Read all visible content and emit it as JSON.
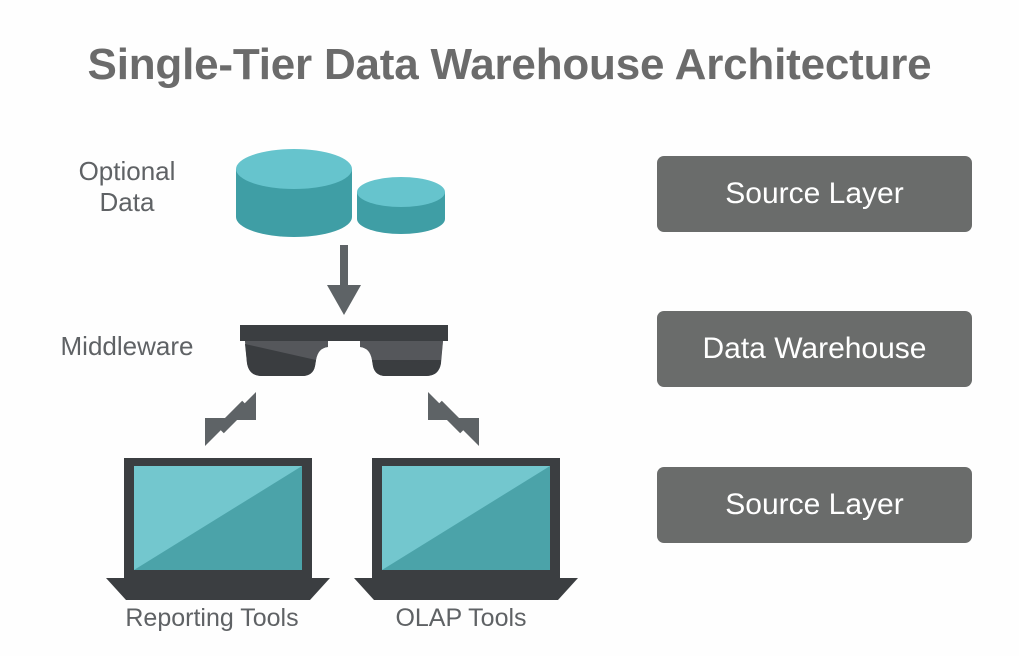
{
  "title": "Single-Tier Data Warehouse Architecture",
  "left_labels": {
    "optional_data": "Optional\nData",
    "optional_data_line1": "Optional",
    "optional_data_line2": "Data",
    "middleware": "Middleware"
  },
  "tool_labels": {
    "reporting_tools": "Reporting Tools",
    "olap_tools": "OLAP Tools"
  },
  "layer_boxes": [
    {
      "label": "Source Layer"
    },
    {
      "label": "Data Warehouse"
    },
    {
      "label": "Source Layer"
    }
  ],
  "icons": {
    "database_large": "database-cylinder-icon",
    "database_small": "database-cylinder-small-icon",
    "middleware": "sunglasses-middleware-icon",
    "laptop_left": "laptop-icon",
    "laptop_right": "laptop-icon",
    "arrow_down": "arrow-down-icon",
    "arrow_double_left": "double-arrow-diagonal-icon",
    "arrow_double_right": "double-arrow-diagonal-icon"
  },
  "colors": {
    "background": "#fefefe",
    "title_gray": "#6b6b6b",
    "label_gray": "#5f6265",
    "box_gray": "#6a6c6b",
    "box_text": "#ffffff",
    "teal_light": "#6cc6cf",
    "teal_mid": "#5bb8c0",
    "teal_dark": "#3f9ea5",
    "teal_screen_light": "#73c7ce",
    "teal_screen_dark": "#4ba3a9",
    "dark_gray": "#3b3e41",
    "mid_gray": "#5e6366",
    "lens_dark": "#3a3d40",
    "lens_light": "#6b6e71"
  }
}
